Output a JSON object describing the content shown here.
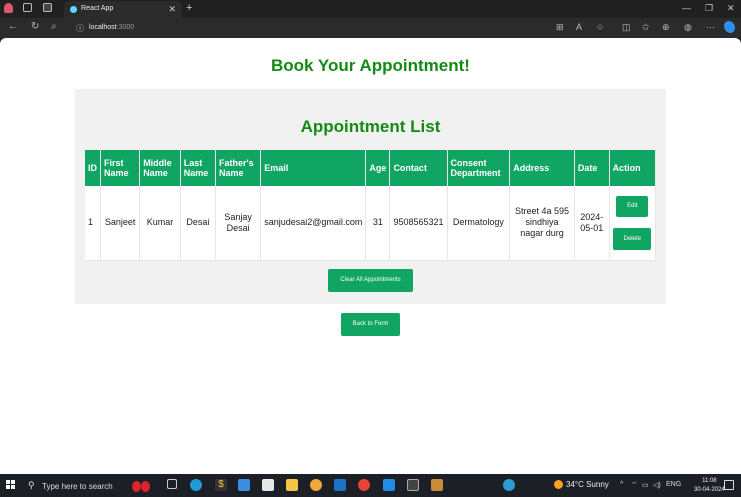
{
  "browser": {
    "tab_title": "React App",
    "address_host": "localhost",
    "address_port": ":3000"
  },
  "page": {
    "heading": "Book Your Appointment!",
    "list_heading": "Appointment List",
    "table": {
      "headers": [
        "ID",
        "First Name",
        "Middle Name",
        "Last Name",
        "Father's Name",
        "Email",
        "Age",
        "Contact",
        "Consent Department",
        "Address",
        "Date",
        "Action"
      ],
      "rows": [
        {
          "id": "1",
          "first_name": "Sanjeet",
          "middle_name": "Kumar",
          "last_name": "Desai",
          "father_name": "Sanjay Desai",
          "email": "sanjudesai2@gmail.com",
          "age": "31",
          "contact": "9508565321",
          "department": "Dermatology",
          "address": "Street 4a 595 sindhiya nagar durg",
          "date": "2024-05-01",
          "edit_label": "Edit",
          "delete_label": "Delete"
        }
      ]
    },
    "clear_label": "Clear All Appointments",
    "back_label": "Back to Form"
  },
  "taskbar": {
    "search_placeholder": "Type here to search",
    "weather": "34°C  Sunny",
    "lang": "ENG",
    "time": "11:08",
    "date": "30-04-2024"
  },
  "colors": {
    "accent_green": "#11a563",
    "heading_green": "#138a13"
  }
}
